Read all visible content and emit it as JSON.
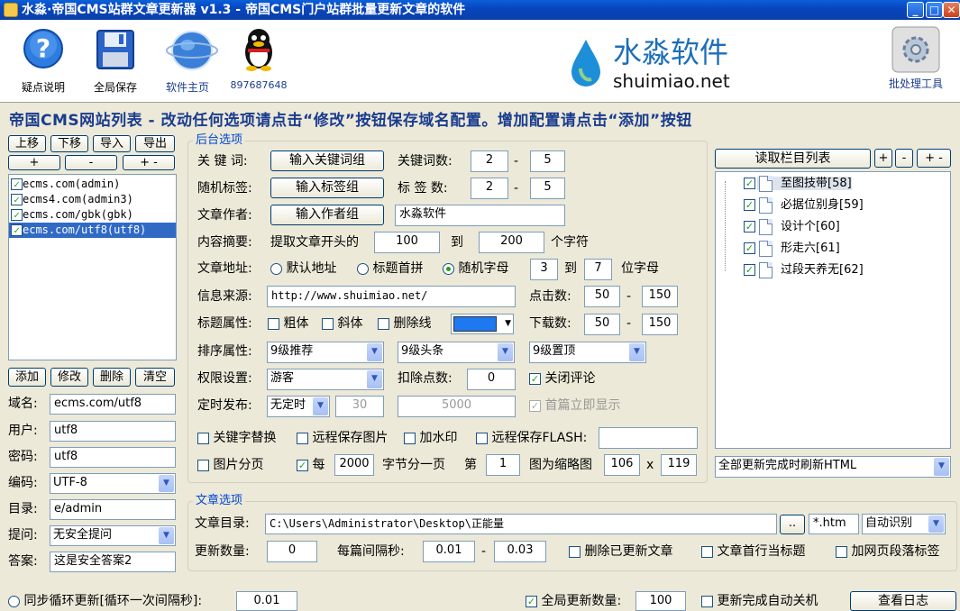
{
  "window": {
    "title": "水淼·帝国CMS站群文章更新器 v1.3 - 帝国CMS门户站群批量更新文章的软件"
  },
  "toolbar": {
    "help_label": "疑点说明",
    "save_label": "全局保存",
    "home_label": "软件主页",
    "qq_label": "897687648",
    "batch_label": "批处理工具",
    "logo_text": "水淼软件",
    "logo_url": "shuimiao.net"
  },
  "heading": "帝国CMS网站列表 - 改动任何选项请点击“修改”按钮保存域名配置。增加配置请点击“添加”按钮",
  "left": {
    "btn_up": "上移",
    "btn_down": "下移",
    "btn_import": "导入",
    "btn_export": "导出",
    "btn_plus": "+",
    "btn_minus": "-",
    "btn_plusminus": "+ -",
    "sites": [
      "ecms.com(admin)",
      "ecms4.com(admin3)",
      "ecms.com/gbk(gbk)",
      "ecms.com/utf8(utf8)"
    ],
    "btn_add": "添加",
    "btn_modify": "修改",
    "btn_delete": "删除",
    "btn_clear": "清空",
    "domain_label": "域名:",
    "domain_value": "ecms.com/utf8",
    "user_label": "用户:",
    "user_value": "utf8",
    "password_label": "密码:",
    "password_value": "utf8",
    "encoding_label": "编码:",
    "encoding_value": "UTF-8",
    "dir_label": "目录:",
    "dir_value": "e/admin",
    "question_label": "提问:",
    "question_value": "无安全提问",
    "answer_label": "答案:",
    "answer_value": "这是安全答案2"
  },
  "backend": {
    "group_title": "后台选项",
    "keyword_label": "关 键 词:",
    "keyword_btn": "输入关键词组",
    "keyword_count_label": "关键词数:",
    "keyword_min": "2",
    "keyword_max": "5",
    "tag_label": "随机标签:",
    "tag_btn": "输入标签组",
    "tag_count_label": "标 签 数:",
    "tag_min": "2",
    "tag_max": "5",
    "author_label": "文章作者:",
    "author_btn": "输入作者组",
    "author_value": "水淼软件",
    "summary_label": "内容摘要:",
    "summary_prefix": "提取文章开头的",
    "summary_from": "100",
    "summary_to_label": "到",
    "summary_to": "200",
    "summary_unit": "个字符",
    "url_label": "文章地址:",
    "url_opt1": "默认地址",
    "url_opt2": "标题首拼",
    "url_opt3": "随机字母",
    "url_from": "3",
    "url_to_label": "到",
    "url_to": "7",
    "url_unit": "位字母",
    "source_label": "信息来源:",
    "source_value": "http://www.shuimiao.net/",
    "hits_label": "点击数:",
    "hits_min": "50",
    "hits_max": "150",
    "title_attr_label": "标题属性:",
    "bold_label": "粗体",
    "italic_label": "斜体",
    "strike_label": "删除线",
    "title_color": "#1e78f0",
    "downloads_label": "下载数:",
    "downloads_min": "50",
    "downloads_max": "150",
    "sort_label": "排序属性:",
    "sort_rec": "9级推荐",
    "sort_head": "9级头条",
    "sort_top": "9级置顶",
    "perm_label": "权限设置:",
    "perm_value": "游客",
    "deduct_label": "扣除点数:",
    "deduct_value": "0",
    "close_comment_label": "关闭评论",
    "schedule_label": "定时发布:",
    "schedule_value": "无定时",
    "schedule_a": "30",
    "schedule_b": "5000",
    "first_show_label": "首篇立即显示",
    "dash": "-"
  },
  "mid": {
    "keyword_replace": "关键字替换",
    "remote_img": "远程保存图片",
    "watermark": "加水印",
    "remote_flash": "远程保存FLASH:",
    "paginate": "图片分页",
    "every_label": "每",
    "every_value": "2000",
    "per_page": "字节分一页",
    "nth_label": "第",
    "nth_value": "1",
    "thumb_label": "图为缩略图",
    "thumb_w": "106",
    "thumb_x": "x",
    "thumb_h": "119"
  },
  "right": {
    "read_btn": "读取栏目列表",
    "btn_plus": "+",
    "btn_minus": "-",
    "btn_plusminus": "+ -",
    "columns": [
      "至图技带[58]",
      "必据位别身[59]",
      "设计个[60]",
      "形走六[61]",
      "过段天养无[62]"
    ],
    "refresh_value": "全部更新完成时刷新HTML"
  },
  "article": {
    "group_title": "文章选项",
    "dir_label": "文章目录:",
    "dir_value": "C:\\Users\\Administrator\\Desktop\\正能量",
    "browse_btn": "..",
    "ext_value": "*.htm",
    "encoding_value": "自动识别",
    "count_label": "更新数量:",
    "count_value": "0",
    "interval_label": "每篇间隔秒:",
    "interval_min": "0.01",
    "interval_max": "0.03",
    "delete_updated": "删除已更新文章",
    "first_line_title": "文章首行当标题",
    "add_page_tag": "加网页段落标签"
  },
  "bottom": {
    "sync_loop": "同步循环更新[循环一次间隔秒]:",
    "sync_value": "0.01",
    "global_count": "全局更新数量:",
    "global_value": "100",
    "auto_shutdown": "更新完成自动关机",
    "log_btn": "查看日志"
  }
}
